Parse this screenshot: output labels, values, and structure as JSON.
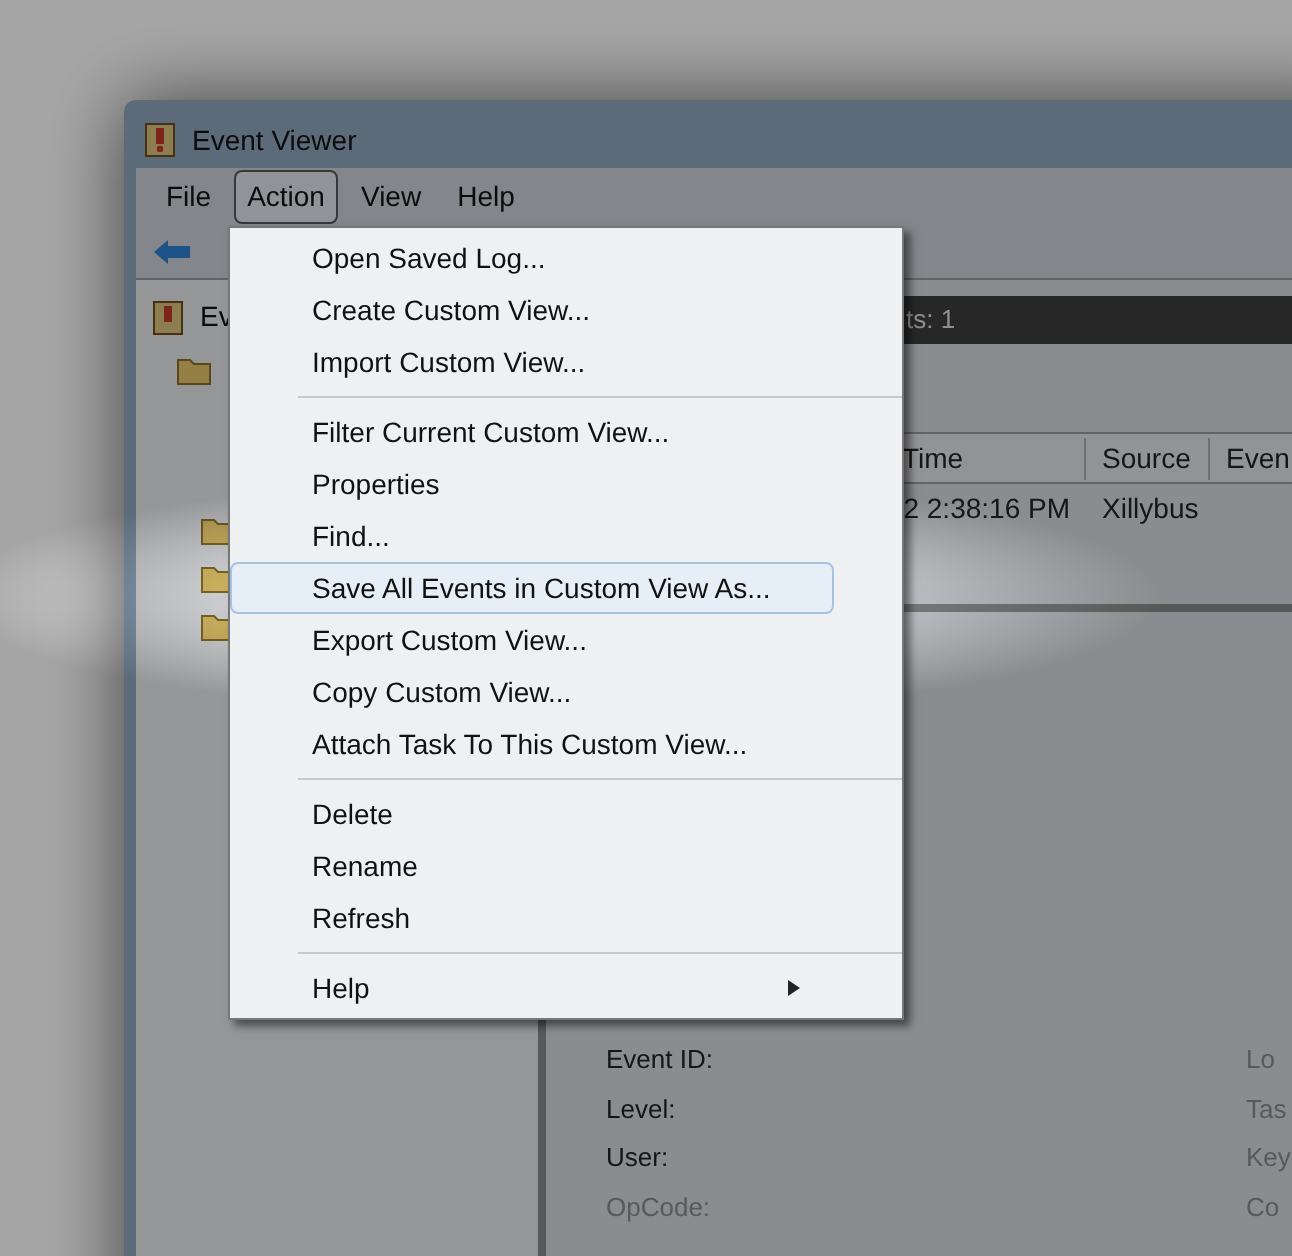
{
  "window": {
    "title": "Event Viewer"
  },
  "menu_bar": [
    {
      "label": "File",
      "selected": false
    },
    {
      "label": "Action",
      "selected": true
    },
    {
      "label": "View",
      "selected": false
    },
    {
      "label": "Help",
      "selected": false
    }
  ],
  "tree": {
    "items": [
      {
        "label": "Ev",
        "expanded": true
      }
    ]
  },
  "header": {
    "text": "ts: 1"
  },
  "table": {
    "columns": [
      "Time",
      "Source",
      "Even"
    ],
    "rows": [
      [
        "2 2:38:16 PM",
        "Xillybus"
      ]
    ]
  },
  "details": {
    "left": [
      {
        "label": "Event ID:",
        "disabled": false
      },
      {
        "label": "Level:",
        "disabled": false
      },
      {
        "label": "User:",
        "disabled": false
      },
      {
        "label": "OpCode:",
        "disabled": true
      }
    ],
    "right": [
      {
        "label": "Lo",
        "disabled": true
      },
      {
        "label": "Tas",
        "disabled": true
      },
      {
        "label": "Key",
        "disabled": true
      },
      {
        "label": "Co",
        "disabled": true
      }
    ]
  },
  "action_menu": {
    "groups": [
      [
        {
          "label": "Open Saved Log...",
          "selected": false,
          "submenu": false
        },
        {
          "label": "Create Custom View...",
          "selected": false,
          "submenu": false
        },
        {
          "label": "Import Custom View...",
          "selected": false,
          "submenu": false
        }
      ],
      [
        {
          "label": "Filter Current Custom View...",
          "selected": false,
          "submenu": false
        },
        {
          "label": "Properties",
          "selected": false,
          "submenu": false
        },
        {
          "label": "Find...",
          "selected": false,
          "submenu": false
        },
        {
          "label": "Save All Events in Custom View As...",
          "selected": true,
          "submenu": false
        },
        {
          "label": "Export Custom View...",
          "selected": false,
          "submenu": false
        },
        {
          "label": "Copy Custom View...",
          "selected": false,
          "submenu": false
        },
        {
          "label": "Attach Task To This Custom View...",
          "selected": false,
          "submenu": false
        }
      ],
      [
        {
          "label": "Delete",
          "selected": false,
          "submenu": false
        },
        {
          "label": "Rename",
          "selected": false,
          "submenu": false
        },
        {
          "label": "Refresh",
          "selected": false,
          "submenu": false
        }
      ],
      [
        {
          "label": "Help",
          "selected": false,
          "submenu": true
        }
      ]
    ]
  }
}
